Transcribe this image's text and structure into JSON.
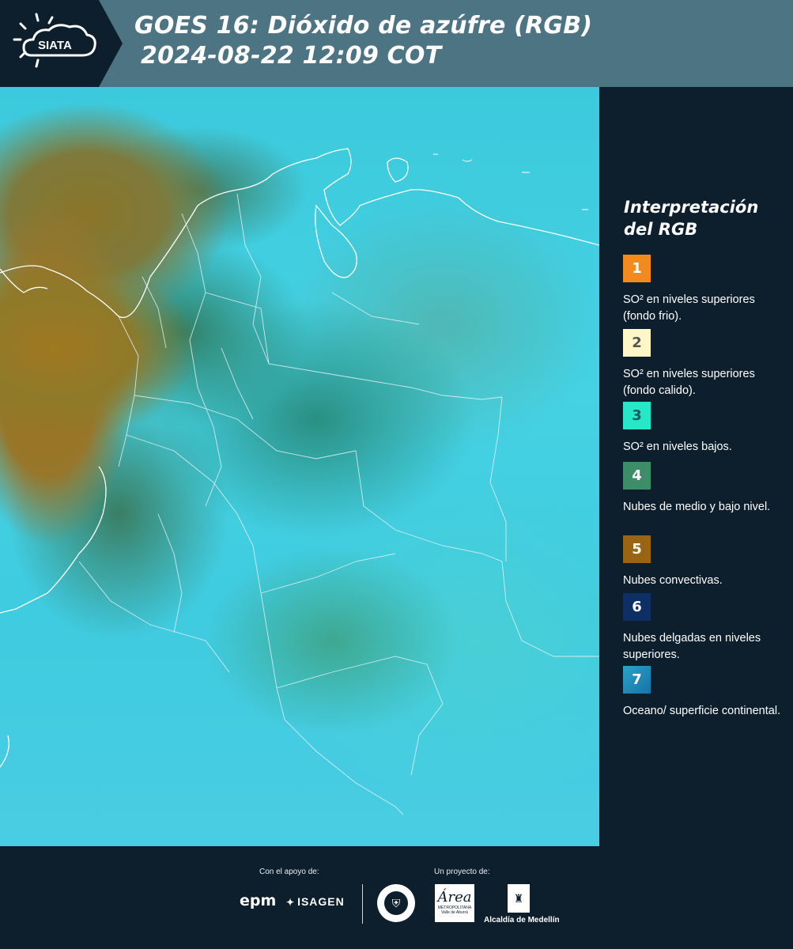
{
  "header": {
    "logo_text": "SIATA",
    "title_line1": "GOES 16: Dióxido de azúfre (RGB)",
    "title_line2": "2024-08-22 12:09 COT"
  },
  "legend": {
    "title": "Interpretación del RGB",
    "items": [
      {
        "number": "1",
        "color": "#f28a1e",
        "text_color": "#ffffff",
        "label": "SO² en niveles superiores (fondo frio)."
      },
      {
        "number": "2",
        "color": "#fdf6c6",
        "text_color": "#555555",
        "label": "SO² en niveles superiores (fondo calido)."
      },
      {
        "number": "3",
        "color": "#27e7c9",
        "text_color": "#1a5c5a",
        "label": "SO² en niveles bajos."
      },
      {
        "number": "4",
        "color": "#3d8e68",
        "text_color": "#ffffff",
        "label": "Nubes de medio y bajo nivel."
      },
      {
        "number": "5",
        "color": "#9a6512",
        "text_color": "#ffffff",
        "label": "Nubes convectivas."
      },
      {
        "number": "6",
        "color": "#0e2f63",
        "text_color": "#ffffff",
        "label": "Nubes delgadas en niveles superiores."
      },
      {
        "number": "7",
        "color": "#1f8fbd",
        "text_color": "#ffffff",
        "label": "Oceano/ superficie continental."
      }
    ]
  },
  "footer": {
    "support_label": "Con el apoyo de:",
    "project_label": "Un proyecto de:",
    "sponsor1": "epm",
    "sponsor2": "ISAGEN",
    "partner_area": "Área",
    "partner_area_sub": "METROPOLITANA Valle de Aburrá",
    "partner_alcaldia": "Alcaldía de Medellín"
  }
}
